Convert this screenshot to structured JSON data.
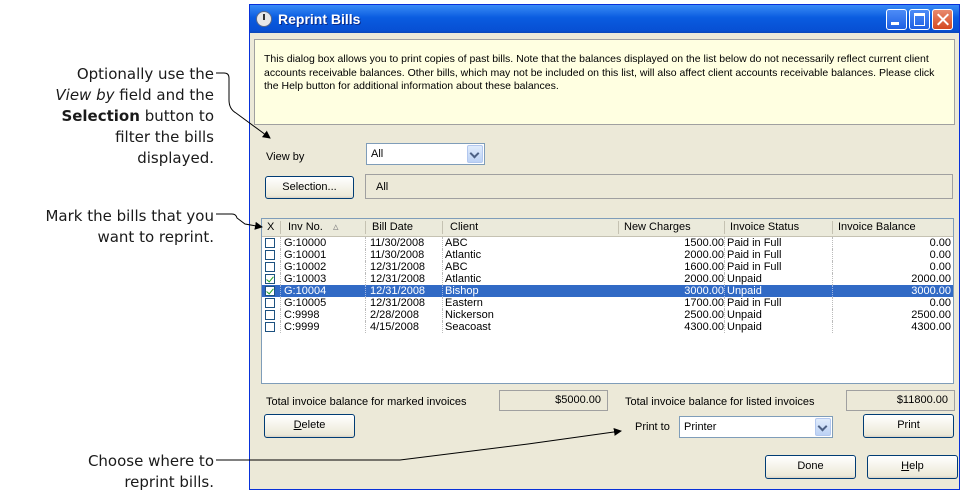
{
  "callouts": {
    "c1_line1": "Optionally use the",
    "c1_line2_italic": "View by",
    "c1_line2_rest": " field and the",
    "c1_line3_bold": "Selection",
    "c1_line3_rest": " button to",
    "c1_line4": "filter the bills",
    "c1_line5": "displayed.",
    "c2_line1": "Mark the bills that you",
    "c2_line2": "want to reprint.",
    "c3_line1": "Choose where to",
    "c3_line2": "reprint bills."
  },
  "window": {
    "title": "Reprint Bills",
    "icon": "clock-icon"
  },
  "info_text": "This dialog box allows you to print copies of past bills. Note that the balances displayed on the list below do not necessarily reflect current client accounts receivable balances. Other bills, which may not be included on this list, will also affect client accounts receivable balances. Please click the Help button for additional information about these balances.",
  "view_by": {
    "label": "View by",
    "value": "All"
  },
  "selection": {
    "button_label": "Selection...",
    "value": "All"
  },
  "table": {
    "headers": {
      "mark": "X",
      "inv_no": "Inv No.",
      "bill_date": "Bill Date",
      "client": "Client",
      "new_charges": "New Charges",
      "invoice_status": "Invoice Status",
      "invoice_balance": "Invoice Balance"
    },
    "sort_icon": "sort-ascending-icon",
    "rows": [
      {
        "checked": false,
        "inv_no": "G:10000",
        "bill_date": "11/30/2008",
        "client": "ABC",
        "new_charges": "1500.00",
        "status": "Paid in Full",
        "balance": "0.00",
        "selected": false
      },
      {
        "checked": false,
        "inv_no": "G:10001",
        "bill_date": "11/30/2008",
        "client": "Atlantic",
        "new_charges": "2000.00",
        "status": "Paid in Full",
        "balance": "0.00",
        "selected": false
      },
      {
        "checked": false,
        "inv_no": "G:10002",
        "bill_date": "12/31/2008",
        "client": "ABC",
        "new_charges": "1600.00",
        "status": "Paid in Full",
        "balance": "0.00",
        "selected": false
      },
      {
        "checked": true,
        "inv_no": "G:10003",
        "bill_date": "12/31/2008",
        "client": "Atlantic",
        "new_charges": "2000.00",
        "status": "Unpaid",
        "balance": "2000.00",
        "selected": false
      },
      {
        "checked": true,
        "inv_no": "G:10004",
        "bill_date": "12/31/2008",
        "client": "Bishop",
        "new_charges": "3000.00",
        "status": "Unpaid",
        "balance": "3000.00",
        "selected": true
      },
      {
        "checked": false,
        "inv_no": "G:10005",
        "bill_date": "12/31/2008",
        "client": "Eastern",
        "new_charges": "1700.00",
        "status": "Paid in Full",
        "balance": "0.00",
        "selected": false
      },
      {
        "checked": false,
        "inv_no": "C:9998",
        "bill_date": "2/28/2008",
        "client": "Nickerson",
        "new_charges": "2500.00",
        "status": "Unpaid",
        "balance": "2500.00",
        "selected": false
      },
      {
        "checked": false,
        "inv_no": "C:9999",
        "bill_date": "4/15/2008",
        "client": "Seacoast",
        "new_charges": "4300.00",
        "status": "Unpaid",
        "balance": "4300.00",
        "selected": false
      }
    ]
  },
  "totals": {
    "marked_label": "Total invoice balance for marked invoices",
    "marked_value": "$5000.00",
    "listed_label": "Total invoice balance for listed invoices",
    "listed_value": "$11800.00"
  },
  "buttons": {
    "delete_first": "D",
    "delete_rest": "elete",
    "print": "Print",
    "done": "Done",
    "help_first": "H",
    "help_rest": "elp"
  },
  "print_to": {
    "label": "Print to",
    "value": "Printer"
  },
  "colors": {
    "title_bar": "#0a5ce0",
    "info_background": "#ffffe1",
    "selection": "#316ac5",
    "dialog_face": "#ece9d8"
  }
}
